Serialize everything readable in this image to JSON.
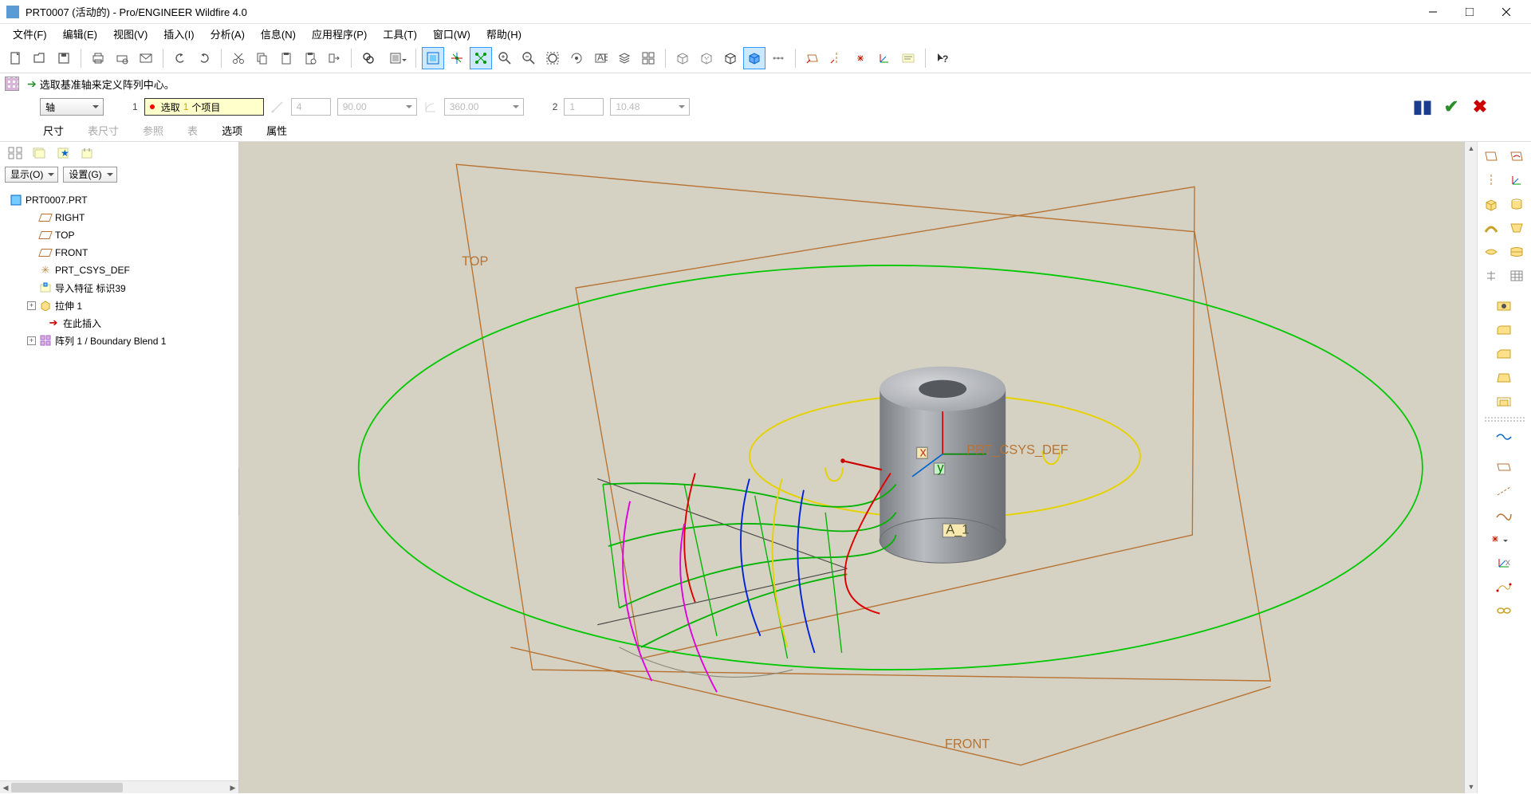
{
  "title": "PRT0007 (活动的) - Pro/ENGINEER Wildfire 4.0",
  "menu": [
    "文件(F)",
    "编辑(E)",
    "视图(V)",
    "插入(I)",
    "分析(A)",
    "信息(N)",
    "应用程序(P)",
    "工具(T)",
    "窗口(W)",
    "帮助(H)"
  ],
  "info_message": "选取基准轴来定义阵列中心。",
  "dashboard": {
    "type_dropdown": "轴",
    "group1_num": "1",
    "select_prefix": "选取",
    "select_count": "1",
    "select_suffix": "个项目",
    "val1": "4",
    "val1_drop": "90.00",
    "val2": "360.00",
    "group2_num": "2",
    "val3": "1",
    "val3_drop": "10.48"
  },
  "subtabs": [
    {
      "label": "尺寸",
      "disabled": false
    },
    {
      "label": "表尺寸",
      "disabled": true
    },
    {
      "label": "参照",
      "disabled": true
    },
    {
      "label": "表",
      "disabled": true
    },
    {
      "label": "选项",
      "disabled": false
    },
    {
      "label": "属性",
      "disabled": false
    }
  ],
  "left_panel": {
    "display_dropdown": "显示(O)",
    "settings_dropdown": "设置(G)",
    "root": "PRT0007.PRT",
    "items": [
      {
        "label": "RIGHT",
        "icon": "plane"
      },
      {
        "label": "TOP",
        "icon": "plane"
      },
      {
        "label": "FRONT",
        "icon": "plane"
      },
      {
        "label": "PRT_CSYS_DEF",
        "icon": "csys"
      },
      {
        "label": "导入特征 标识39",
        "icon": "import"
      },
      {
        "label": "拉伸 1",
        "icon": "extrude",
        "expandable": true
      },
      {
        "label": "在此插入",
        "icon": "insert"
      },
      {
        "label": "阵列 1 / Boundary Blend 1",
        "icon": "pattern",
        "expandable": true
      }
    ]
  },
  "viewport": {
    "top_label": "TOP",
    "front_label": "FRONT",
    "csys_label": "PRT_CSYS_DEF",
    "axis_label": "A_1"
  }
}
